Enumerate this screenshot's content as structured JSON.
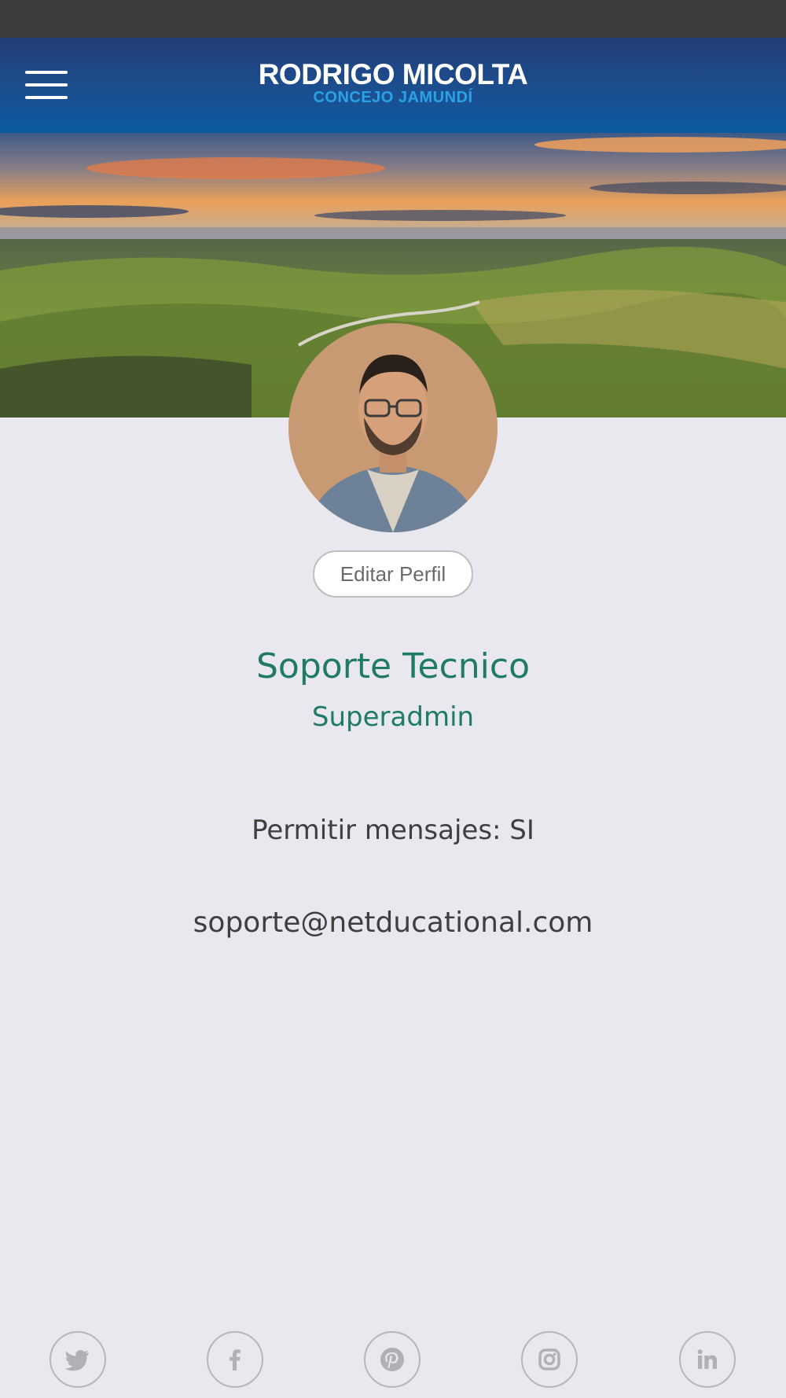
{
  "header": {
    "title": "RODRIGO MICOLTA",
    "subtitle": "CONCEJO JAMUNDÍ",
    "menu_icon": "hamburger-menu-icon",
    "colors": {
      "top": "#223d78",
      "bottom": "#0b5aa0",
      "subtitle": "#2aa3e6"
    }
  },
  "cover": {
    "description_icon": "landscape-cover-image"
  },
  "profile": {
    "avatar_icon": "user-avatar",
    "edit_button_label": "Editar Perfil",
    "name": "Soporte Tecnico",
    "role": "Superadmin",
    "messages_setting": "Permitir mensajes: SI",
    "email": "soporte@netducational.com",
    "name_color": "#1f7a68"
  },
  "social": {
    "items": [
      {
        "icon": "twitter-icon"
      },
      {
        "icon": "facebook-icon"
      },
      {
        "icon": "pinterest-icon"
      },
      {
        "icon": "instagram-icon"
      },
      {
        "icon": "linkedin-icon"
      }
    ]
  }
}
